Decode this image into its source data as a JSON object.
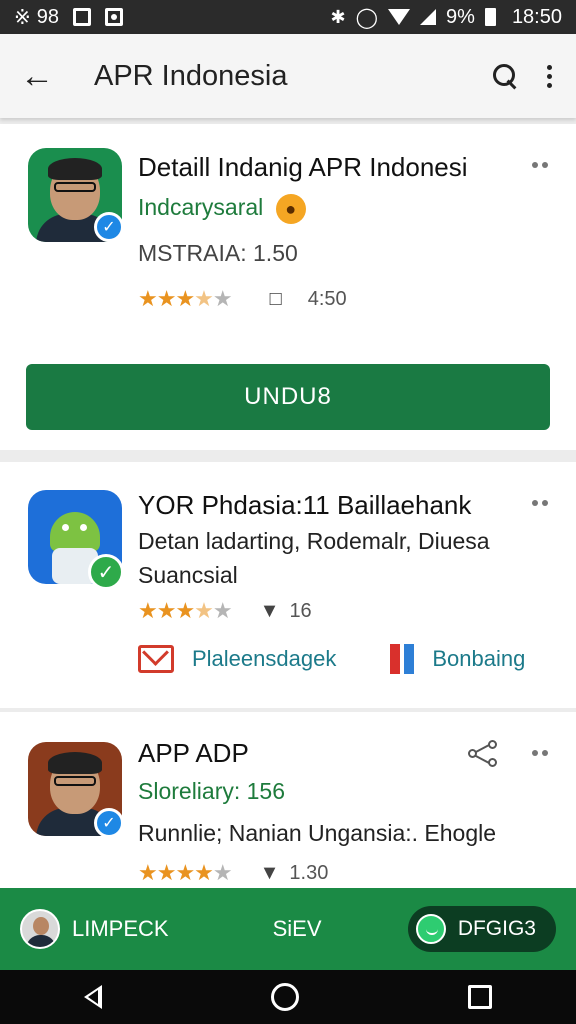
{
  "status_bar": {
    "left_text": "98",
    "battery": "9%",
    "time": "18:50",
    "icons": [
      "bluetooth-icon",
      "gallery-icon",
      "screenshot-icon",
      "alarm-icon",
      "wifi-icon",
      "signal-icon",
      "battery-icon"
    ]
  },
  "app_bar": {
    "title": "APR Indonesia",
    "icons": [
      "back-arrow-icon",
      "search-icon",
      "more-vert-icon"
    ]
  },
  "cards": [
    {
      "title": "Detaill Indanig APR Indonesi",
      "subtitle": "Indcarysaral",
      "meta": "MSTRAIA: 1.50",
      "stars": 3.5,
      "stat": "4:50",
      "button": "UNDU8"
    },
    {
      "title": "YOR Phdasia:11 Baillaehank",
      "line1": "Detan ladarting, Rodemalr, Diuesa",
      "line2": "Suancsial",
      "stars": 3.5,
      "stat": "16",
      "link1": "Plaleensdagek",
      "link2": "Bonbaing"
    },
    {
      "title": "APP ADP",
      "subtitle": "Sloreliary: 156",
      "line1": "Runnlie; Nanian Ungansia:. Ehogle",
      "stars": 4,
      "stat": "1.30"
    }
  ],
  "bottom_bar": {
    "left_label": "LIMPECK",
    "center_label": "SiEV",
    "right_label": "DFGIG3"
  },
  "colors": {
    "primary_green": "#1a7a43",
    "bottom_green": "#1b8a45",
    "star_orange": "#e99320",
    "link_teal": "#1c7a8a",
    "mail_red": "#d23b2b",
    "verified_blue": "#1e88e5"
  }
}
